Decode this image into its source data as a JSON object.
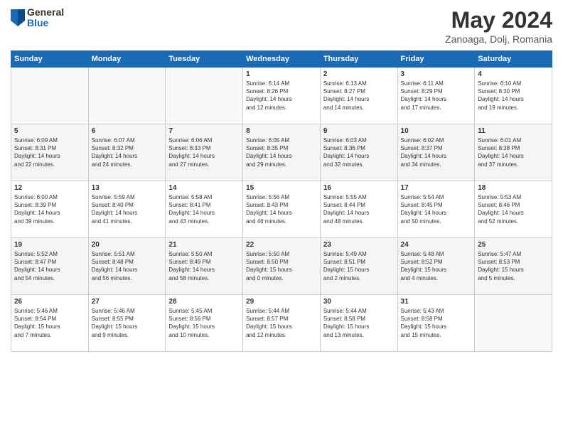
{
  "logo": {
    "general": "General",
    "blue": "Blue"
  },
  "title": "May 2024",
  "subtitle": "Zanoaga, Dolj, Romania",
  "weekdays": [
    "Sunday",
    "Monday",
    "Tuesday",
    "Wednesday",
    "Thursday",
    "Friday",
    "Saturday"
  ],
  "weeks": [
    [
      {
        "day": "",
        "info": ""
      },
      {
        "day": "",
        "info": ""
      },
      {
        "day": "",
        "info": ""
      },
      {
        "day": "1",
        "info": "Sunrise: 6:14 AM\nSunset: 8:26 PM\nDaylight: 14 hours\nand 12 minutes."
      },
      {
        "day": "2",
        "info": "Sunrise: 6:13 AM\nSunset: 8:27 PM\nDaylight: 14 hours\nand 14 minutes."
      },
      {
        "day": "3",
        "info": "Sunrise: 6:11 AM\nSunset: 8:29 PM\nDaylight: 14 hours\nand 17 minutes."
      },
      {
        "day": "4",
        "info": "Sunrise: 6:10 AM\nSunset: 8:30 PM\nDaylight: 14 hours\nand 19 minutes."
      }
    ],
    [
      {
        "day": "5",
        "info": "Sunrise: 6:09 AM\nSunset: 8:31 PM\nDaylight: 14 hours\nand 22 minutes."
      },
      {
        "day": "6",
        "info": "Sunrise: 6:07 AM\nSunset: 8:32 PM\nDaylight: 14 hours\nand 24 minutes."
      },
      {
        "day": "7",
        "info": "Sunrise: 6:06 AM\nSunset: 8:33 PM\nDaylight: 14 hours\nand 27 minutes."
      },
      {
        "day": "8",
        "info": "Sunrise: 6:05 AM\nSunset: 8:35 PM\nDaylight: 14 hours\nand 29 minutes."
      },
      {
        "day": "9",
        "info": "Sunrise: 6:03 AM\nSunset: 8:36 PM\nDaylight: 14 hours\nand 32 minutes."
      },
      {
        "day": "10",
        "info": "Sunrise: 6:02 AM\nSunset: 8:37 PM\nDaylight: 14 hours\nand 34 minutes."
      },
      {
        "day": "11",
        "info": "Sunrise: 6:01 AM\nSunset: 8:38 PM\nDaylight: 14 hours\nand 37 minutes."
      }
    ],
    [
      {
        "day": "12",
        "info": "Sunrise: 6:00 AM\nSunset: 8:39 PM\nDaylight: 14 hours\nand 39 minutes."
      },
      {
        "day": "13",
        "info": "Sunrise: 5:59 AM\nSunset: 8:40 PM\nDaylight: 14 hours\nand 41 minutes."
      },
      {
        "day": "14",
        "info": "Sunrise: 5:58 AM\nSunset: 8:41 PM\nDaylight: 14 hours\nand 43 minutes."
      },
      {
        "day": "15",
        "info": "Sunrise: 5:56 AM\nSunset: 8:43 PM\nDaylight: 14 hours\nand 46 minutes."
      },
      {
        "day": "16",
        "info": "Sunrise: 5:55 AM\nSunset: 8:44 PM\nDaylight: 14 hours\nand 48 minutes."
      },
      {
        "day": "17",
        "info": "Sunrise: 5:54 AM\nSunset: 8:45 PM\nDaylight: 14 hours\nand 50 minutes."
      },
      {
        "day": "18",
        "info": "Sunrise: 5:53 AM\nSunset: 8:46 PM\nDaylight: 14 hours\nand 52 minutes."
      }
    ],
    [
      {
        "day": "19",
        "info": "Sunrise: 5:52 AM\nSunset: 8:47 PM\nDaylight: 14 hours\nand 54 minutes."
      },
      {
        "day": "20",
        "info": "Sunrise: 5:51 AM\nSunset: 8:48 PM\nDaylight: 14 hours\nand 56 minutes."
      },
      {
        "day": "21",
        "info": "Sunrise: 5:50 AM\nSunset: 8:49 PM\nDaylight: 14 hours\nand 58 minutes."
      },
      {
        "day": "22",
        "info": "Sunrise: 5:50 AM\nSunset: 8:50 PM\nDaylight: 15 hours\nand 0 minutes."
      },
      {
        "day": "23",
        "info": "Sunrise: 5:49 AM\nSunset: 8:51 PM\nDaylight: 15 hours\nand 2 minutes."
      },
      {
        "day": "24",
        "info": "Sunrise: 5:48 AM\nSunset: 8:52 PM\nDaylight: 15 hours\nand 4 minutes."
      },
      {
        "day": "25",
        "info": "Sunrise: 5:47 AM\nSunset: 8:53 PM\nDaylight: 15 hours\nand 5 minutes."
      }
    ],
    [
      {
        "day": "26",
        "info": "Sunrise: 5:46 AM\nSunset: 8:54 PM\nDaylight: 15 hours\nand 7 minutes."
      },
      {
        "day": "27",
        "info": "Sunrise: 5:46 AM\nSunset: 8:55 PM\nDaylight: 15 hours\nand 9 minutes."
      },
      {
        "day": "28",
        "info": "Sunrise: 5:45 AM\nSunset: 8:56 PM\nDaylight: 15 hours\nand 10 minutes."
      },
      {
        "day": "29",
        "info": "Sunrise: 5:44 AM\nSunset: 8:57 PM\nDaylight: 15 hours\nand 12 minutes."
      },
      {
        "day": "30",
        "info": "Sunrise: 5:44 AM\nSunset: 8:58 PM\nDaylight: 15 hours\nand 13 minutes."
      },
      {
        "day": "31",
        "info": "Sunrise: 5:43 AM\nSunset: 8:58 PM\nDaylight: 15 hours\nand 15 minutes."
      },
      {
        "day": "",
        "info": ""
      }
    ]
  ]
}
